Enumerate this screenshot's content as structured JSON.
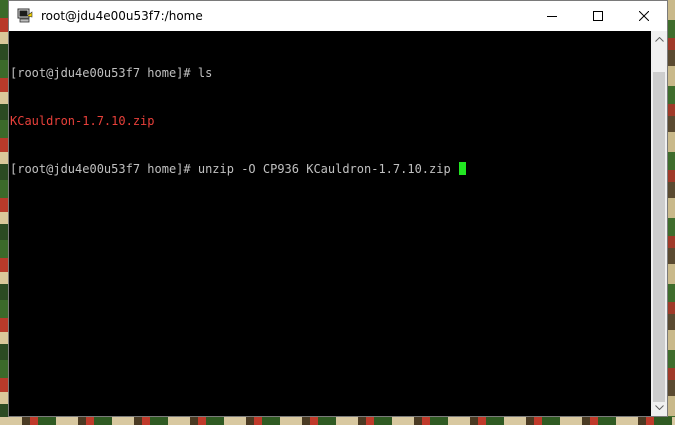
{
  "window": {
    "title": "root@jdu4e00u53f7:/home",
    "icons": {
      "app": "putty-terminal-icon",
      "minimize": "minimize-icon",
      "maximize": "maximize-icon",
      "close": "close-icon"
    }
  },
  "terminal": {
    "lines": [
      {
        "prompt": "[root@jdu4e00u53f7 home]# ",
        "command": "ls"
      },
      {
        "output": "KCauldron-1.7.10.zip"
      },
      {
        "prompt": "[root@jdu4e00u53f7 home]# ",
        "command": "unzip -O CP936 KCauldron-1.7.10.zip "
      }
    ],
    "colors": {
      "text": "#c0c0c0",
      "file_highlight": "#e8403a",
      "cursor": "#22e622",
      "background": "#000000"
    }
  }
}
